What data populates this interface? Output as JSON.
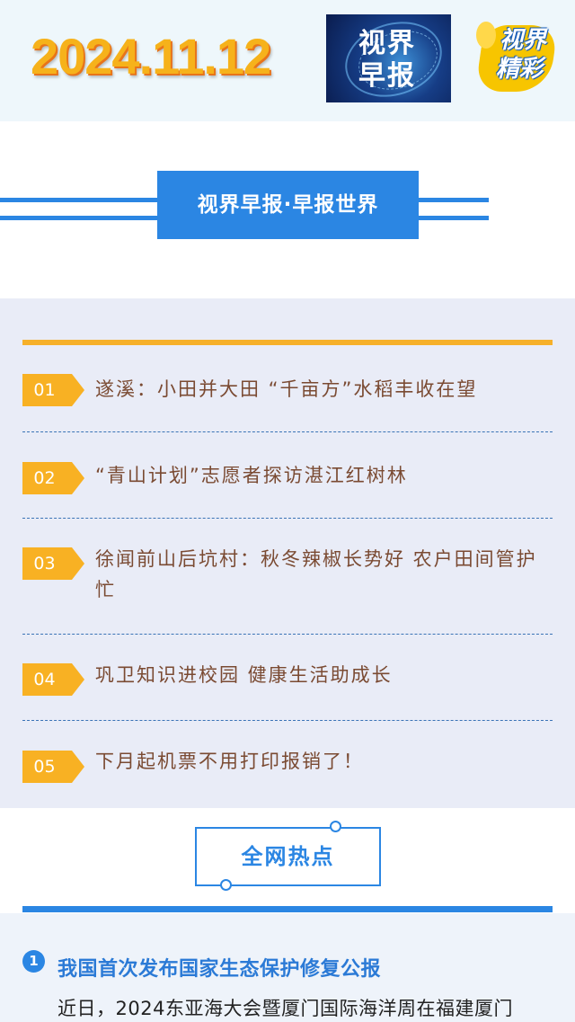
{
  "header": {
    "date": "2024.11.12",
    "logo1_line1": "视界",
    "logo1_line2": "早报",
    "logo2_line1": "视界",
    "logo2_line2": "精彩"
  },
  "section_title": "视界早报·早报世界",
  "news": [
    {
      "num": "01",
      "text": "遂溪：小田并大田 “千亩方”水稻丰收在望"
    },
    {
      "num": "02",
      "text": "“青山计划”志愿者探访湛江红树林"
    },
    {
      "num": "03",
      "text": "徐闻前山后坑村：秋冬辣椒长势好 农户田间管护忙"
    },
    {
      "num": "04",
      "text": "巩卫知识进校园 健康生活助成长"
    },
    {
      "num": "05",
      "text": "下月起机票不用打印报销了！"
    }
  ],
  "hot": {
    "title": "全网热点",
    "article_num": "1",
    "article_title": "我国首次发布国家生态保护修复公报",
    "article_body": "近日，2024东亚海大会暨厦门国际海洋周在福建厦门"
  },
  "colors": {
    "brand_blue": "#2b86e3",
    "accent_orange": "#f8b123",
    "date_orange": "#f6b21b",
    "news_text": "#7a4a32"
  }
}
